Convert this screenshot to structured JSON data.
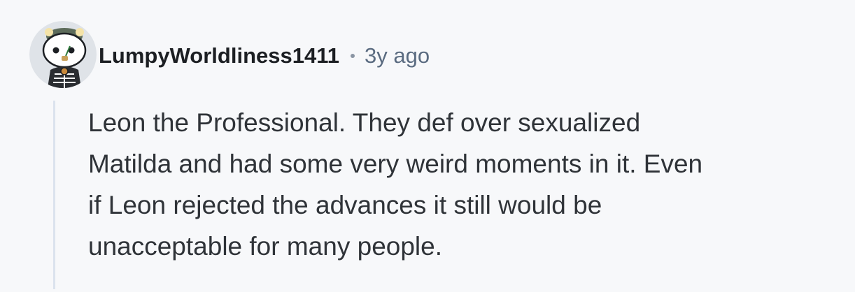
{
  "comment": {
    "avatar_icon": "snoo-avatar-icon",
    "username": "LumpyWorldliness1411",
    "separator": "•",
    "timestamp": "3y ago",
    "body_lines": [
      "Leon the Professional. They def over sexualized",
      "Matilda and had some very weird moments in it. Even",
      "if Leon rejected the advances it still would be",
      "unacceptable for many people."
    ]
  },
  "colors": {
    "background": "#f7f8fa",
    "thread_line": "#dbe3ee",
    "username": "#1c1f23",
    "timestamp": "#5a6b80",
    "body": "#2f3338"
  }
}
